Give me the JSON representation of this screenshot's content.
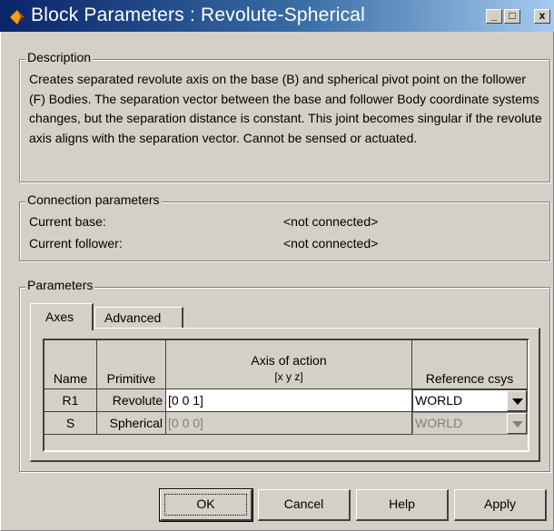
{
  "window": {
    "title": "Block Parameters : Revolute-Spherical",
    "controls": {
      "minimize": "_",
      "maximize": "□",
      "close": "x"
    }
  },
  "description": {
    "label": "Description",
    "text": "Creates separated revolute axis on the base (B) and spherical pivot point on the follower (F) Bodies. The separation vector between the base and follower Body coordinate systems changes, but the separation distance is constant. This joint becomes singular if the revolute axis aligns with the separation vector. Cannot be sensed or actuated."
  },
  "connection": {
    "label": "Connection parameters",
    "base_label": "Current base:",
    "base_value": "<not connected>",
    "follower_label": "Current follower:",
    "follower_value": "<not connected>"
  },
  "parameters": {
    "label": "Parameters",
    "tabs": [
      {
        "label": "Axes",
        "active": true
      },
      {
        "label": "Advanced",
        "active": false
      }
    ],
    "table": {
      "headers": {
        "name": "Name",
        "primitive": "Primitive",
        "axis": "Axis of action",
        "axis_sub": "[x y z]",
        "ref": "Reference csys"
      },
      "rows": [
        {
          "name": "R1",
          "primitive": "Revolute",
          "axis": "[0 0 1]",
          "ref": "WORLD",
          "enabled": true
        },
        {
          "name": "S",
          "primitive": "Spherical",
          "axis": "[0 0 0]",
          "ref": "WORLD",
          "enabled": false
        }
      ]
    }
  },
  "buttons": {
    "ok": "OK",
    "cancel": "Cancel",
    "help": "Help",
    "apply": "Apply"
  },
  "colors": {
    "title_start": "#0a246a",
    "title_end": "#a6caf0",
    "face": "#d4d0c8",
    "disabled_text": "#808080"
  }
}
